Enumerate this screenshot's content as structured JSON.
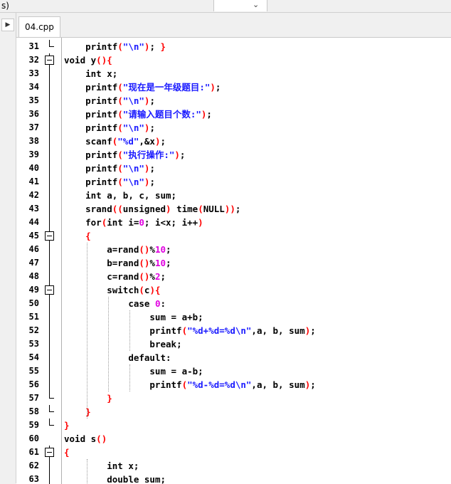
{
  "topbar": {
    "left_text": "s)",
    "dropdown_chevron": "chevron-down-icon"
  },
  "sidebar": {
    "toggle_icon": "triangle-right-icon"
  },
  "tabs": [
    {
      "label": "04.cpp"
    }
  ],
  "editor": {
    "lines": [
      {
        "n": "31",
        "fold": "end",
        "tokens": [
          [
            "t",
            "    printf"
          ],
          [
            "p",
            "("
          ],
          [
            "s",
            "\"\\n\""
          ],
          [
            "p",
            ")"
          ],
          [
            "t",
            "; "
          ],
          [
            "p",
            "}"
          ]
        ]
      },
      {
        "n": "32",
        "fold": "box",
        "tokens": [
          [
            "k",
            "void"
          ],
          [
            "t",
            " y"
          ],
          [
            "p",
            "(){"
          ]
        ]
      },
      {
        "n": "33",
        "fold": "line",
        "tokens": [
          [
            "t",
            "    "
          ],
          [
            "k",
            "int"
          ],
          [
            "t",
            " x;"
          ]
        ]
      },
      {
        "n": "34",
        "fold": "line",
        "tokens": [
          [
            "t",
            "    printf"
          ],
          [
            "p",
            "("
          ],
          [
            "s",
            "\"现在是一年级题目:\""
          ],
          [
            "p",
            ")"
          ],
          [
            "t",
            ";"
          ]
        ]
      },
      {
        "n": "35",
        "fold": "line",
        "tokens": [
          [
            "t",
            "    printf"
          ],
          [
            "p",
            "("
          ],
          [
            "s",
            "\"\\n\""
          ],
          [
            "p",
            ")"
          ],
          [
            "t",
            ";"
          ]
        ]
      },
      {
        "n": "36",
        "fold": "line",
        "tokens": [
          [
            "t",
            "    printf"
          ],
          [
            "p",
            "("
          ],
          [
            "s",
            "\"请输入题目个数:\""
          ],
          [
            "p",
            ")"
          ],
          [
            "t",
            ";"
          ]
        ]
      },
      {
        "n": "37",
        "fold": "line",
        "tokens": [
          [
            "t",
            "    printf"
          ],
          [
            "p",
            "("
          ],
          [
            "s",
            "\"\\n\""
          ],
          [
            "p",
            ")"
          ],
          [
            "t",
            ";"
          ]
        ]
      },
      {
        "n": "38",
        "fold": "line",
        "tokens": [
          [
            "t",
            "    scanf"
          ],
          [
            "p",
            "("
          ],
          [
            "s",
            "\"%d\""
          ],
          [
            "t",
            ",&x"
          ],
          [
            "p",
            ")"
          ],
          [
            "t",
            ";"
          ]
        ]
      },
      {
        "n": "39",
        "fold": "line",
        "tokens": [
          [
            "t",
            "    printf"
          ],
          [
            "p",
            "("
          ],
          [
            "s",
            "\"执行操作:\""
          ],
          [
            "p",
            ")"
          ],
          [
            "t",
            ";"
          ]
        ]
      },
      {
        "n": "40",
        "fold": "line",
        "tokens": [
          [
            "t",
            "    printf"
          ],
          [
            "p",
            "("
          ],
          [
            "s",
            "\"\\n\""
          ],
          [
            "p",
            ")"
          ],
          [
            "t",
            ";"
          ]
        ]
      },
      {
        "n": "41",
        "fold": "line",
        "tokens": [
          [
            "t",
            "    printf"
          ],
          [
            "p",
            "("
          ],
          [
            "s",
            "\"\\n\""
          ],
          [
            "p",
            ")"
          ],
          [
            "t",
            ";"
          ]
        ]
      },
      {
        "n": "42",
        "fold": "line",
        "tokens": [
          [
            "t",
            "    "
          ],
          [
            "k",
            "int"
          ],
          [
            "t",
            " a, b, c, sum;"
          ]
        ]
      },
      {
        "n": "43",
        "fold": "line",
        "tokens": [
          [
            "t",
            "    srand"
          ],
          [
            "p",
            "(("
          ],
          [
            "k",
            "unsigned"
          ],
          [
            "p",
            ")"
          ],
          [
            "t",
            " time"
          ],
          [
            "p",
            "("
          ],
          [
            "t",
            "NULL"
          ],
          [
            "p",
            "))"
          ],
          [
            "t",
            ";"
          ]
        ]
      },
      {
        "n": "44",
        "fold": "line",
        "tokens": [
          [
            "t",
            "    "
          ],
          [
            "k",
            "for"
          ],
          [
            "p",
            "("
          ],
          [
            "k",
            "int"
          ],
          [
            "t",
            " i="
          ],
          [
            "n",
            "0"
          ],
          [
            "t",
            "; i<x; i++"
          ],
          [
            "p",
            ")"
          ]
        ]
      },
      {
        "n": "45",
        "fold": "box",
        "tokens": [
          [
            "t",
            "    "
          ],
          [
            "p",
            "{"
          ]
        ]
      },
      {
        "n": "46",
        "fold": "line",
        "tokens": [
          [
            "t",
            "        a=rand"
          ],
          [
            "p",
            "()"
          ],
          [
            "t",
            "%"
          ],
          [
            "n",
            "10"
          ],
          [
            "t",
            ";"
          ]
        ]
      },
      {
        "n": "47",
        "fold": "line",
        "tokens": [
          [
            "t",
            "        b=rand"
          ],
          [
            "p",
            "()"
          ],
          [
            "t",
            "%"
          ],
          [
            "n",
            "10"
          ],
          [
            "t",
            ";"
          ]
        ]
      },
      {
        "n": "48",
        "fold": "line",
        "tokens": [
          [
            "t",
            "        c=rand"
          ],
          [
            "p",
            "()"
          ],
          [
            "t",
            "%"
          ],
          [
            "n",
            "2"
          ],
          [
            "t",
            ";"
          ]
        ]
      },
      {
        "n": "49",
        "fold": "box",
        "tokens": [
          [
            "t",
            "        "
          ],
          [
            "k",
            "switch"
          ],
          [
            "p",
            "("
          ],
          [
            "t",
            "c"
          ],
          [
            "p",
            "){"
          ]
        ]
      },
      {
        "n": "50",
        "fold": "line",
        "tokens": [
          [
            "t",
            "            "
          ],
          [
            "k",
            "case"
          ],
          [
            "t",
            " "
          ],
          [
            "n",
            "0"
          ],
          [
            "t",
            ":"
          ]
        ]
      },
      {
        "n": "51",
        "fold": "line",
        "tokens": [
          [
            "t",
            "                sum = a+b;"
          ]
        ]
      },
      {
        "n": "52",
        "fold": "line",
        "tokens": [
          [
            "t",
            "                printf"
          ],
          [
            "p",
            "("
          ],
          [
            "s",
            "\"%d+%d=%d\\n\""
          ],
          [
            "t",
            ",a, b, sum"
          ],
          [
            "p",
            ")"
          ],
          [
            "t",
            ";"
          ]
        ]
      },
      {
        "n": "53",
        "fold": "line",
        "tokens": [
          [
            "t",
            "                "
          ],
          [
            "k",
            "break"
          ],
          [
            "t",
            ";"
          ]
        ]
      },
      {
        "n": "54",
        "fold": "line",
        "tokens": [
          [
            "t",
            "            "
          ],
          [
            "k",
            "default"
          ],
          [
            "t",
            ":"
          ]
        ]
      },
      {
        "n": "55",
        "fold": "line",
        "tokens": [
          [
            "t",
            "                sum = a-b;"
          ]
        ]
      },
      {
        "n": "56",
        "fold": "line",
        "tokens": [
          [
            "t",
            "                printf"
          ],
          [
            "p",
            "("
          ],
          [
            "s",
            "\"%d-%d=%d\\n\""
          ],
          [
            "t",
            ",a, b, sum"
          ],
          [
            "p",
            ")"
          ],
          [
            "t",
            ";"
          ]
        ]
      },
      {
        "n": "57",
        "fold": "end",
        "tokens": [
          [
            "t",
            "        "
          ],
          [
            "p",
            "}"
          ]
        ]
      },
      {
        "n": "58",
        "fold": "end",
        "tokens": [
          [
            "t",
            "    "
          ],
          [
            "p",
            "}"
          ]
        ]
      },
      {
        "n": "59",
        "fold": "end",
        "tokens": [
          [
            "p",
            "}"
          ]
        ]
      },
      {
        "n": "60",
        "fold": "none",
        "tokens": [
          [
            "k",
            "void"
          ],
          [
            "t",
            " s"
          ],
          [
            "p",
            "()"
          ]
        ]
      },
      {
        "n": "61",
        "fold": "box",
        "tokens": [
          [
            "p",
            "{"
          ]
        ]
      },
      {
        "n": "62",
        "fold": "line",
        "tokens": [
          [
            "t",
            "        "
          ],
          [
            "k",
            "int"
          ],
          [
            "t",
            " x;"
          ]
        ]
      },
      {
        "n": "63",
        "fold": "line",
        "tokens": [
          [
            "t",
            "        "
          ],
          [
            "k",
            "double"
          ],
          [
            "t",
            " sum;"
          ]
        ]
      }
    ]
  },
  "colors": {
    "string": "#1a1aff",
    "number": "#e000e0",
    "paren": "#ff0000",
    "keyword": "#000000"
  }
}
